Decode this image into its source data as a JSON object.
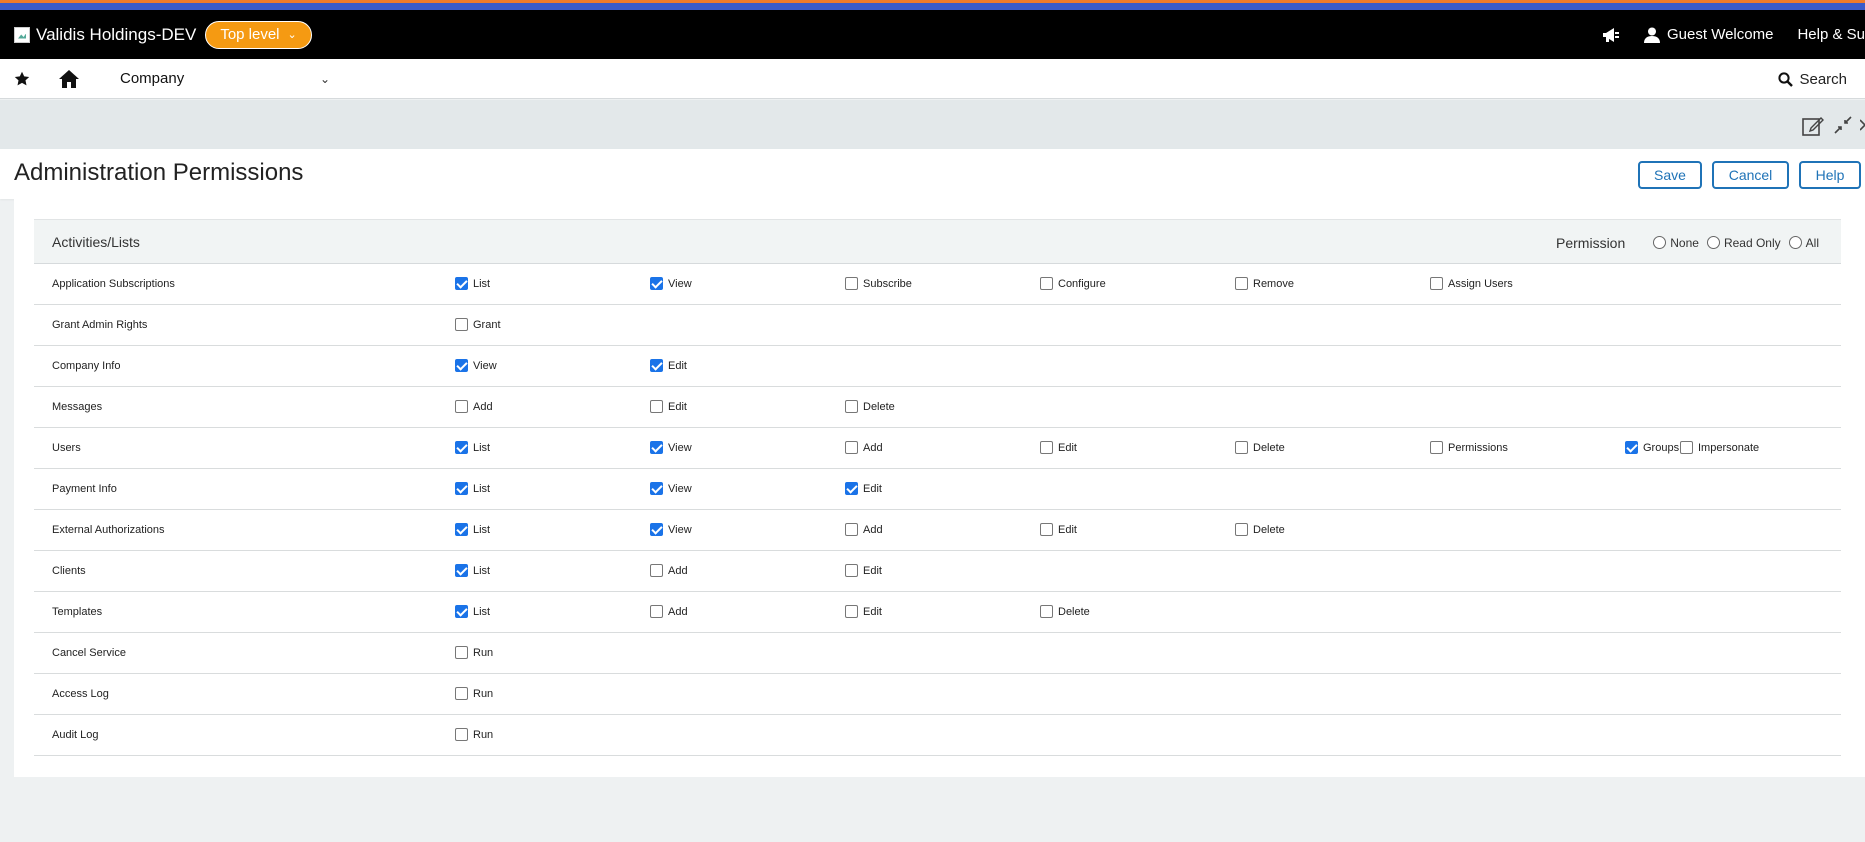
{
  "topbar": {
    "company_name": "Validis Holdings-DEV",
    "level_label": "Top level",
    "user_label": "Guest Welcome",
    "help_label": "Help & Su"
  },
  "navbar": {
    "company_select": "Company",
    "search_label": "Search"
  },
  "page": {
    "title": "Administration Permissions",
    "save_label": "Save",
    "cancel_label": "Cancel",
    "help_label": "Help"
  },
  "table": {
    "heading": "Activities/Lists",
    "permission_label": "Permission",
    "options": [
      "None",
      "Read Only",
      "All"
    ],
    "rows": [
      {
        "label": "Application Subscriptions",
        "items": [
          {
            "label": "List",
            "checked": true
          },
          {
            "label": "View",
            "checked": true
          },
          {
            "label": "Subscribe",
            "checked": false
          },
          {
            "label": "Configure",
            "checked": false
          },
          {
            "label": "Remove",
            "checked": false
          },
          {
            "label": "Assign Users",
            "checked": false
          }
        ]
      },
      {
        "label": "Grant Admin Rights",
        "items": [
          {
            "label": "Grant",
            "checked": false
          }
        ]
      },
      {
        "label": "Company Info",
        "items": [
          {
            "label": "View",
            "checked": true
          },
          {
            "label": "Edit",
            "checked": true
          }
        ]
      },
      {
        "label": "Messages",
        "items": [
          {
            "label": "Add",
            "checked": false
          },
          {
            "label": "Edit",
            "checked": false
          },
          {
            "label": "Delete",
            "checked": false
          }
        ]
      },
      {
        "label": "Users",
        "items": [
          {
            "label": "List",
            "checked": true
          },
          {
            "label": "View",
            "checked": true
          },
          {
            "label": "Add",
            "checked": false
          },
          {
            "label": "Edit",
            "checked": false
          },
          {
            "label": "Delete",
            "checked": false
          },
          {
            "label": "Permissions",
            "checked": false
          },
          {
            "label": "Groups",
            "checked": true
          },
          {
            "label": "Impersonate",
            "checked": false
          }
        ]
      },
      {
        "label": "Payment Info",
        "items": [
          {
            "label": "List",
            "checked": true
          },
          {
            "label": "View",
            "checked": true
          },
          {
            "label": "Edit",
            "checked": true
          }
        ]
      },
      {
        "label": "External Authorizations",
        "items": [
          {
            "label": "List",
            "checked": true
          },
          {
            "label": "View",
            "checked": true
          },
          {
            "label": "Add",
            "checked": false
          },
          {
            "label": "Edit",
            "checked": false
          },
          {
            "label": "Delete",
            "checked": false
          }
        ]
      },
      {
        "label": "Clients",
        "items": [
          {
            "label": "List",
            "checked": true
          },
          {
            "label": "Add",
            "checked": false
          },
          {
            "label": "Edit",
            "checked": false
          }
        ]
      },
      {
        "label": "Templates",
        "items": [
          {
            "label": "List",
            "checked": true
          },
          {
            "label": "Add",
            "checked": false
          },
          {
            "label": "Edit",
            "checked": false
          },
          {
            "label": "Delete",
            "checked": false
          }
        ]
      },
      {
        "label": "Cancel Service",
        "items": [
          {
            "label": "Run",
            "checked": false
          }
        ]
      },
      {
        "label": "Access Log",
        "items": [
          {
            "label": "Run",
            "checked": false
          }
        ]
      },
      {
        "label": "Audit Log",
        "items": [
          {
            "label": "Run",
            "checked": false
          }
        ]
      }
    ]
  },
  "icons": {
    "announce": "megaphone-icon",
    "user": "user-icon",
    "star": "star-icon",
    "home": "home-icon",
    "search": "search-icon",
    "edit": "edit-window-icon",
    "collapse": "collapse-icon"
  }
}
